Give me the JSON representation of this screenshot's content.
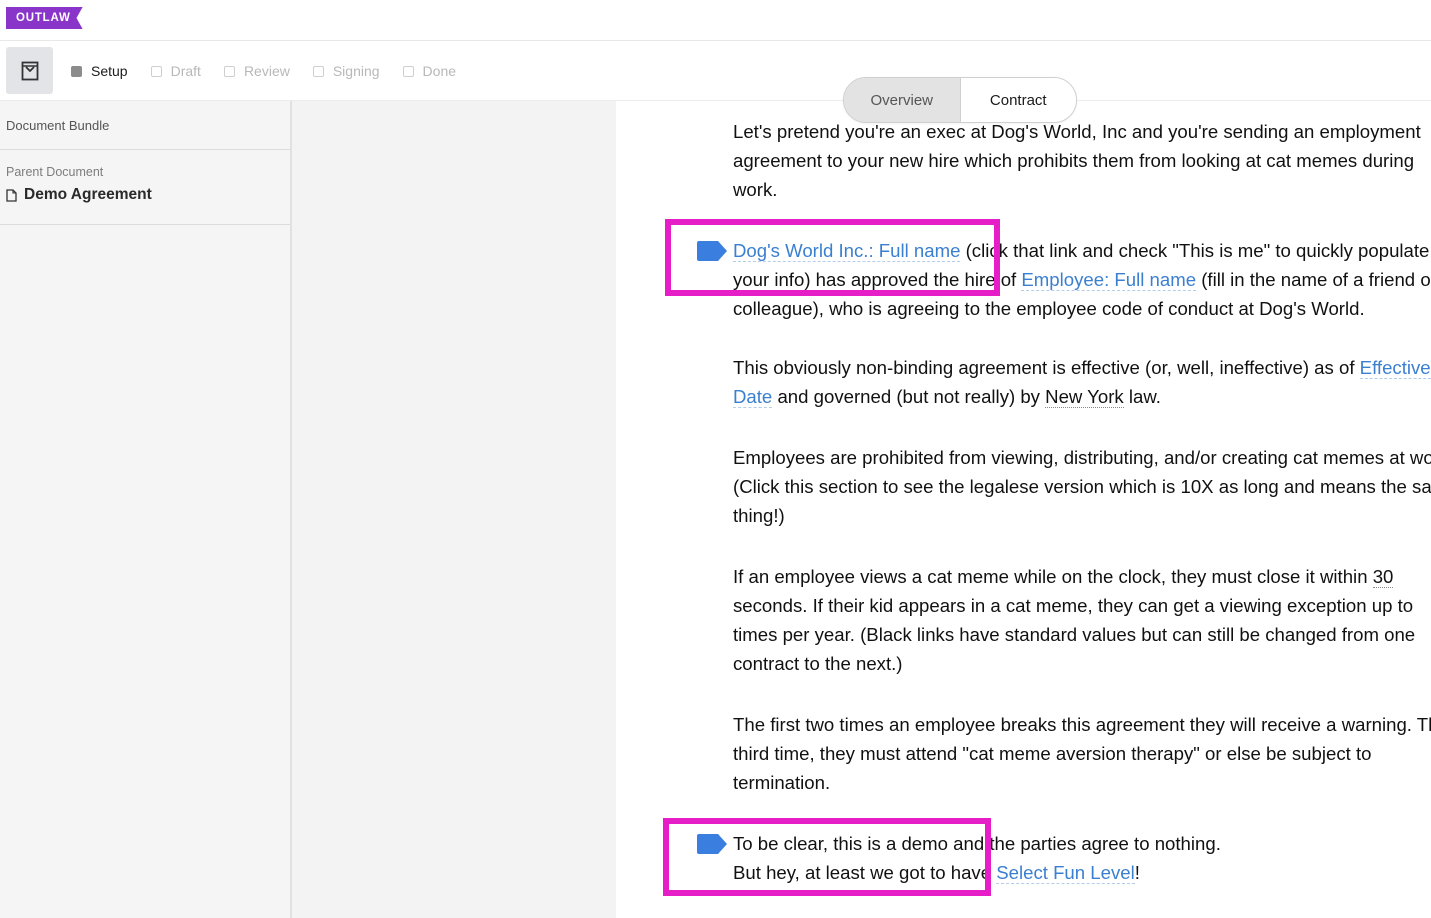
{
  "app": {
    "logo": "OUTLAW"
  },
  "steps": [
    {
      "label": "Setup",
      "active": true
    },
    {
      "label": "Draft",
      "active": false
    },
    {
      "label": "Review",
      "active": false
    },
    {
      "label": "Signing",
      "active": false
    },
    {
      "label": "Done",
      "active": false
    }
  ],
  "sidebar": {
    "bundle_label": "Document Bundle",
    "parent_label": "Parent Document",
    "parent_name": "Demo Agreement"
  },
  "view_toggle": {
    "overview": "Overview",
    "contract": "Contract",
    "selected": "Contract"
  },
  "document": {
    "p1": [
      "Let's pretend you're an exec at Dog's World, Inc and you're sending an employment",
      "agreement to your new hire which prohibits them from looking at cat memes during",
      "work."
    ],
    "p2": {
      "field_company": "Dog's World Inc.: Full name",
      "t1": " (click that link and check \"This is me\" to quickly populate",
      "t2": "your info) has approved the hire of ",
      "field_employee": "Employee: Full name",
      "t3": " (fill in the name of a friend or",
      "t4": "colleague), who is agreeing to the employee code of conduct at Dog's World."
    },
    "p3": {
      "t1": "This obviously non-binding agreement is effective (or, well, ineffective) as of ",
      "field_effective_a": "Effective",
      "field_effective_b": "Date",
      "t2": " and governed (but not really) by ",
      "default_law": "New York",
      "t3": " law."
    },
    "p4": [
      "Employees are prohibited from viewing, distributing, and/or creating cat memes at work.",
      "(Click this section to see the legalese version which is 10X as long and means the same",
      "thing!)"
    ],
    "p5": {
      "t1": "If an employee views a cat meme while on the clock, they must close it within ",
      "default_seconds": "30",
      "t2": "seconds. If their kid appears in a cat meme, they can get a viewing exception up to",
      "t3": "times per year. (Black links have standard values but can still be changed from one",
      "t4": "contract to the next.)"
    },
    "p6": [
      "The first two times an employee breaks this agreement they will receive a warning. The",
      "third time, they must attend \"cat meme aversion therapy\" or else be subject to",
      "termination."
    ],
    "p7": {
      "t1": "To be clear, this is a demo and the parties agree to nothing.",
      "t2": "But hey, at least we got to have ",
      "field_fun": "Select Fun Level",
      "t3": "!"
    }
  },
  "colors": {
    "brand": "#8a35c9",
    "link": "#3a7fd0",
    "highlight": "#e61ec8",
    "tag": "#3a7fe0"
  }
}
